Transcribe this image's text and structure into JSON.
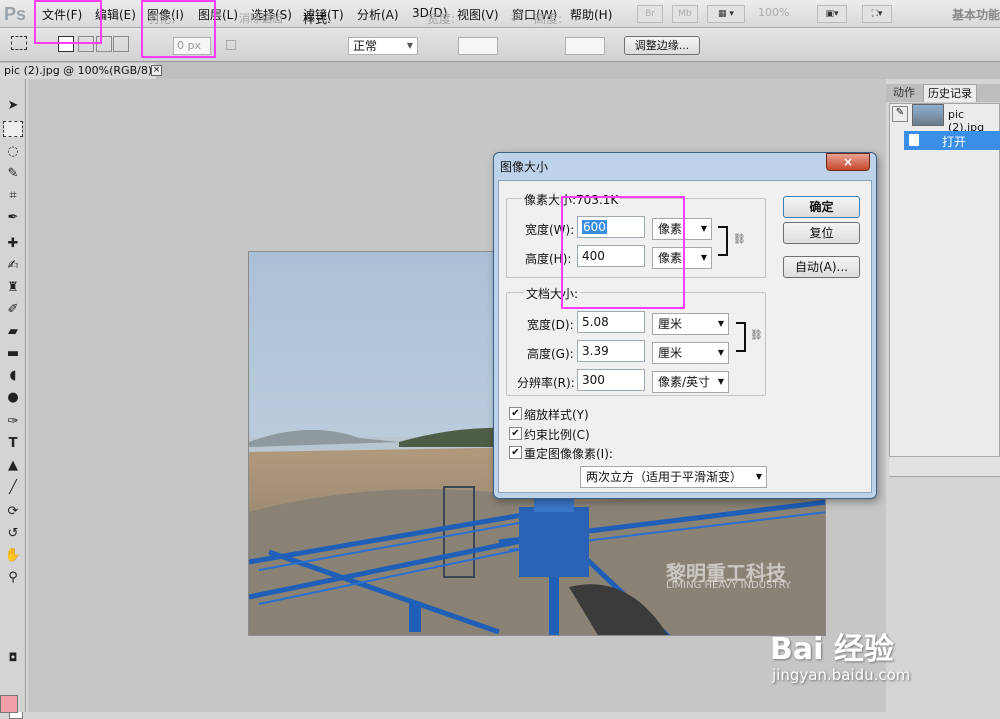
{
  "app": {
    "logo": "Ps",
    "workspace_label": "基本功能"
  },
  "menu": [
    "文件(F)",
    "编辑(E)",
    "图像(I)",
    "图层(L)",
    "选择(S)",
    "滤镜(T)",
    "分析(A)",
    "3D(D)",
    "视图(V)",
    "窗口(W)",
    "帮助(H)"
  ],
  "menu_right": {
    "br": "Br",
    "mb": "Mb",
    "zoom": "100%"
  },
  "options": {
    "feather_label": "羽化:",
    "feather_value": "0 px",
    "antialias_label": "消除锯齿",
    "style_label": "样式:",
    "style_value": "正常",
    "width_label": "宽度:",
    "height_label": "高度:",
    "refine_button": "调整边缘..."
  },
  "document_tab": {
    "title": "pic (2).jpg @ 100%(RGB/8)",
    "close": "×"
  },
  "panels": {
    "tab_actions": "动作",
    "tab_history": "历史记录",
    "snapshot_name": "pic (2).jpg",
    "history_open": "打开"
  },
  "dialog": {
    "title": "图像大小",
    "close": "×",
    "pixel_group_title": "像素大小:703.1K",
    "pixel_width_label": "宽度(W):",
    "pixel_width_value": "600",
    "pixel_width_unit": "像素",
    "pixel_height_label": "高度(H):",
    "pixel_height_value": "400",
    "pixel_height_unit": "像素",
    "doc_group_title": "文档大小:",
    "doc_width_label": "宽度(D):",
    "doc_width_value": "5.08",
    "doc_width_unit": "厘米",
    "doc_height_label": "高度(G):",
    "doc_height_value": "3.39",
    "doc_height_unit": "厘米",
    "resolution_label": "分辨率(R):",
    "resolution_value": "300",
    "resolution_unit": "像素/英寸",
    "scale_styles_label": "缩放样式(Y)",
    "constrain_label": "约束比例(C)",
    "resample_label": "重定图像像素(I):",
    "resample_method": "两次立方（适用于平滑渐变）",
    "ok_button": "确定",
    "reset_button": "复位",
    "auto_button": "自动(A)..."
  },
  "watermarks": {
    "company_cn": "黎明重工科技",
    "company_en": "LIMING HEAVY INDUSTRY",
    "baidu": "Bai 经验",
    "baidu_url": "jingyan.baidu.com"
  },
  "colors": {
    "highlight": "#ff3dff",
    "selection_blue": "#3a8ee6",
    "foreground_swatch": "#f4a0a8"
  }
}
